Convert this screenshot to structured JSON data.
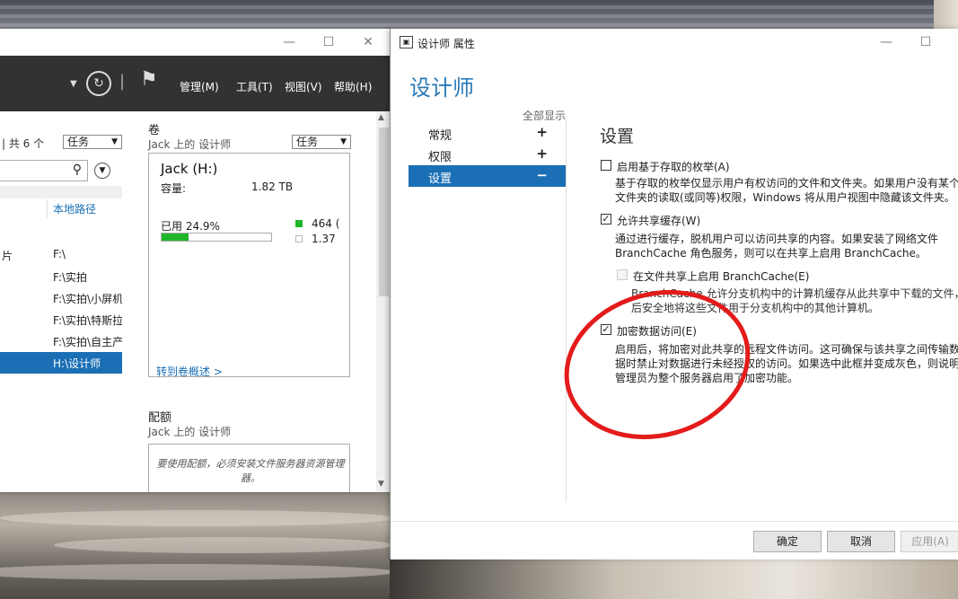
{
  "server_manager": {
    "window_controls": [
      "—",
      "☐",
      "✕"
    ],
    "menu": [
      "管理(M)",
      "工具(T)",
      "视图(V)",
      "帮助(H)"
    ],
    "shares": {
      "count_text": "| 共 6 个",
      "task_label": "任务",
      "column_local_path": "本地路径",
      "rows": [
        {
          "name": "片",
          "path": "F:\\"
        },
        {
          "name": "",
          "path": "F:\\实拍"
        },
        {
          "name": "",
          "path": "F:\\实拍\\小屏机"
        },
        {
          "name": "",
          "path": "F:\\实拍\\特斯拉"
        },
        {
          "name": "",
          "path": "F:\\实拍\\自主产"
        },
        {
          "name": "",
          "path": "H:\\设计师",
          "selected": true
        }
      ]
    },
    "volume": {
      "section_title": "卷",
      "section_sub": "Jack 上的 设计师",
      "task_label": "任务",
      "name": "Jack (H:)",
      "capacity_label": "容量:",
      "capacity_value": "1.82 TB",
      "used_label": "已用 24.9%",
      "used_fraction": 0.249,
      "legend_used": "464 (",
      "legend_free": "1.37",
      "used_color": "#1fb62a",
      "link": "转到卷概述 >"
    },
    "quota": {
      "section_title": "配额",
      "section_sub": "Jack 上的 设计师",
      "message": "要使用配额，必须安装文件服务器资源管理器。"
    }
  },
  "dialog": {
    "title": "设计师 属性",
    "window_controls": [
      "—",
      "☐"
    ],
    "heading": "设计师",
    "nav": {
      "show_all": "全部显示",
      "items": [
        {
          "label": "常规",
          "sym": "+"
        },
        {
          "label": "权限",
          "sym": "+"
        },
        {
          "label": "设置",
          "sym": "−",
          "active": true
        }
      ]
    },
    "settings_title": "设置",
    "options": [
      {
        "label": "启用基于存取的枚举(A)",
        "checked": false,
        "desc": [
          "基于存取的枚举仅显示用户有权访问的文件和文件夹。如果用户没有某个",
          "文件夹的读取(或同等)权限，Windows 将从用户视图中隐藏该文件夹。"
        ]
      },
      {
        "label": "允许共享缓存(W)",
        "checked": true,
        "desc": [
          "通过进行缓存，脱机用户可以访问共享的内容。如果安装了网络文件",
          "BranchCache 角色服务，则可以在共享上启用 BranchCache。"
        ]
      },
      {
        "label": "在文件共享上启用 BranchCache(E)",
        "checked": false,
        "disabled": true,
        "desc": [
          "BranchCache 允许分支机构中的计算机缓存从此共享中下载的文件，",
          "后安全地将这些文件用于分支机构中的其他计算机。"
        ]
      },
      {
        "label": "加密数据访问(E)",
        "checked": true,
        "desc": [
          "启用后，将加密对此共享的远程文件访问。这可确保与该共享之间传输数",
          "据时禁止对数据进行未经授权的访问。如果选中此框并变成灰色，则说明",
          "管理员为整个服务器启用了加密功能。"
        ]
      }
    ],
    "buttons": {
      "ok": "确定",
      "cancel": "取消",
      "apply": "应用(A)"
    },
    "annotation_color": "#e41b1b"
  }
}
